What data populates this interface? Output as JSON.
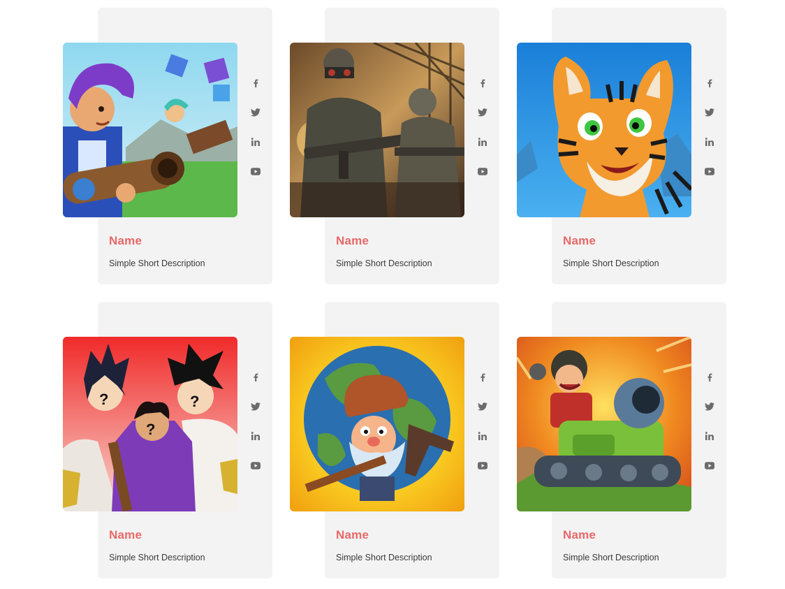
{
  "cards": [
    {
      "name": "Name",
      "description": "Simple Short Description",
      "image": "game-art-hero-with-cannon"
    },
    {
      "name": "Name",
      "description": "Simple Short Description",
      "image": "game-art-soldiers-shooter"
    },
    {
      "name": "Name",
      "description": "Simple Short Description",
      "image": "game-art-cartoon-tiger"
    },
    {
      "name": "Name",
      "description": "Simple Short Description",
      "image": "game-art-anime-mystery-characters"
    },
    {
      "name": "Name",
      "description": "Simple Short Description",
      "image": "game-art-prospector-globe"
    },
    {
      "name": "Name",
      "description": "Simple Short Description",
      "image": "game-art-tank-rider"
    }
  ],
  "social_icons": [
    "facebook-icon",
    "twitter-icon",
    "linkedin-icon",
    "youtube-icon"
  ],
  "colors": {
    "card_bg": "#f3f3f3",
    "name": "#e86868",
    "description": "#3a3a3a",
    "icon": "#6b6b6b"
  }
}
